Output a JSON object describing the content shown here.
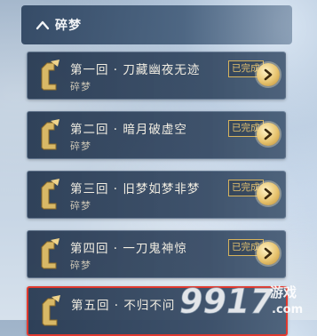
{
  "header": {
    "title": "碎梦",
    "collapse_icon": "chevron-up-icon"
  },
  "chapters": [
    {
      "name": "第一回 · 刀藏幽夜无迹",
      "subtitle": "碎梦",
      "status": "已完成"
    },
    {
      "name": "第二回 · 暗月破虚空",
      "subtitle": "碎梦",
      "status": "已完成"
    },
    {
      "name": "第三回 · 旧梦如梦非梦",
      "subtitle": "碎梦",
      "status": "已完成"
    },
    {
      "name": "第四回 · 一刀鬼神惊",
      "subtitle": "碎梦",
      "status": "已完成"
    },
    {
      "name": "第五回 · 不归不问",
      "subtitle": "",
      "status": ""
    }
  ],
  "watermark": {
    "text": "9917",
    "suffix": "游戏",
    "domain": ".com"
  },
  "colors": {
    "accent_gold": "#e3c16f",
    "highlight_red": "#e0392f",
    "card_bg": "#2c3f58"
  }
}
